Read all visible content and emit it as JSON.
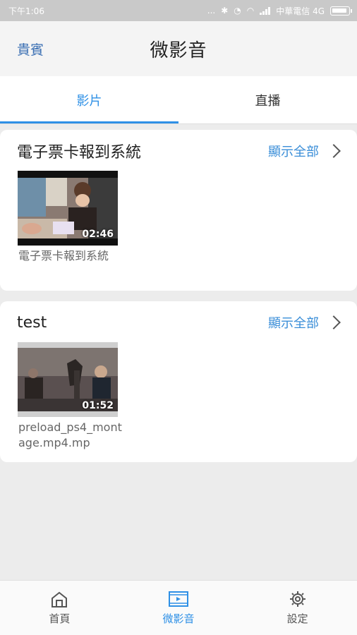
{
  "status_bar": {
    "time": "下午1:06",
    "dots": "...",
    "carrier": "中華電信 4G"
  },
  "header": {
    "left_label": "貴賓",
    "title": "微影音"
  },
  "tabs": [
    {
      "label": "影片",
      "active": true
    },
    {
      "label": "直播",
      "active": false
    }
  ],
  "sections": [
    {
      "title": "電子票卡報到系統",
      "show_all": "顯示全部",
      "videos": [
        {
          "duration": "02:46",
          "caption": "電子票卡報到系統"
        }
      ]
    },
    {
      "title": "test",
      "show_all": "顯示全部",
      "videos": [
        {
          "duration": "01:52",
          "caption": "preload_ps4_montage.mp4.mp"
        }
      ]
    }
  ],
  "bottom_nav": [
    {
      "label": "首頁",
      "icon": "home-icon",
      "active": false
    },
    {
      "label": "微影音",
      "icon": "film-icon",
      "active": true
    },
    {
      "label": "設定",
      "icon": "gear-icon",
      "active": false
    }
  ],
  "colors": {
    "accent": "#2e90e6",
    "link": "#3a8ed8",
    "background": "#ececec"
  }
}
